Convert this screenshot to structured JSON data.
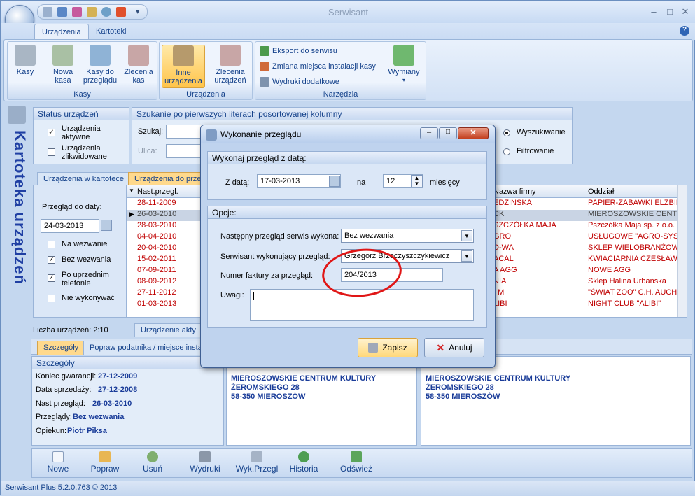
{
  "app": {
    "title": "Serwisant"
  },
  "ribbon": {
    "tabs": [
      "Urządzenia",
      "Kartoteki"
    ],
    "groups": {
      "kasy": {
        "title": "Kasy",
        "buttons": [
          "Kasy",
          "Nowa kasa",
          "Kasy do przeglądu",
          "Zlecenia kas"
        ]
      },
      "urzadzenia": {
        "title": "Urządzenia",
        "buttons": [
          "Inne urządzenia",
          "Zlecenia urządzeń"
        ]
      },
      "narzedzia": {
        "title": "Narzędzia",
        "small": [
          "Eksport do serwisu",
          "Zmiana miejsca instalacji kasy",
          "Wydruki dodatkowe"
        ],
        "big": "Wymiany"
      }
    }
  },
  "side_title": "Kartoteka urządzeń",
  "status_panel": {
    "title": "Status urządzeń",
    "opt1": "Urządzenia aktywne",
    "opt2": "Urządzenia zlikwidowane"
  },
  "search_panel": {
    "title": "Szukanie po pierwszych literach posortowanej kolumny",
    "szukaj": "Szukaj:",
    "ulica": "Ulica:",
    "mode1": "Wyszukiwanie",
    "mode2": "Filtrowanie"
  },
  "list_tabs": [
    "Urządzenia w kartotece",
    "Urządzenia do przeglądu"
  ],
  "filter": {
    "label": "Przegląd do daty:",
    "date": "24-03-2013",
    "opts": [
      "Na wezwanie",
      "Bez wezwania",
      "Po uprzednim telefonie",
      "Nie wykonywać"
    ]
  },
  "grid": {
    "col1": "Nast.przegl.",
    "col2": "Nazwa firmy",
    "col3": "Oddział",
    "rows": [
      {
        "d": "28-11-2009",
        "f": "EDZIŃSKA",
        "o": "PAPIER-ZABAWKI ELŻBIET"
      },
      {
        "d": "26-03-2010",
        "f": "CK",
        "o": "MIEROSZOWSKIE CENTRUM"
      },
      {
        "d": "28-03-2010",
        "f": "SZCZÓŁKA MAJA",
        "o": "Pszczółka Maja sp. z o.o."
      },
      {
        "d": "04-04-2010",
        "f": "GRO",
        "o": "USŁUGOWE \"AGRO-SYSTE"
      },
      {
        "d": "20-04-2010",
        "f": "D-WA",
        "o": "SKLEP WIELOBRANŻOWY"
      },
      {
        "d": "15-02-2011",
        "f": "ACAL",
        "o": "KWIACIARNIA CZESŁAWA"
      },
      {
        "d": "07-09-2011",
        "f": "A AGG",
        "o": "NOWE AGG"
      },
      {
        "d": "08-09-2012",
        "f": "NIA",
        "o": "Sklep  Halina Urbańska"
      },
      {
        "d": "27-11-2012",
        "f": "I M",
        "o": "\"ŚWIAT ZOO\" C.H. AUCHA"
      },
      {
        "d": "01-03-2013",
        "f": "LIBI",
        "o": "NIGHT CLUB \"ALIBI\""
      }
    ]
  },
  "count": "Liczba urządzeń:  2:10",
  "aktywne_tab": "Urządzenie akty",
  "detail_tabs": [
    "Szczegóły",
    "Popraw podatnika / miejsce instal"
  ],
  "details": {
    "title": "Szczegóły",
    "gwarancja_label": "Koniec gwarancji:",
    "gwarancja": "27-12-2009",
    "sprzedaz_label": "Data sprzedaży:",
    "sprzedaz": "27-12-2008",
    "przeglad_label": "Nast przegląd:",
    "przeglad": "26-03-2010",
    "przeglady_label": "Przeglądy:",
    "przeglady": "Bez wezwania",
    "opiekun_label": "Opiekun:",
    "opiekun": "Piotr Piksa"
  },
  "addr1": [
    "MIEROSZOWSKIE CENTRUM KULTURY",
    "ŻEROMSKIEGO 28",
    "58-350 MIEROSZÓW"
  ],
  "addr2": [
    "MIEROSZOWSKIE CENTRUM KULTURY",
    "ŻEROMSKIEGO 28",
    "58-350 MIEROSZÓW"
  ],
  "toolbar": [
    "Nowe",
    "Popraw",
    "Usuń",
    "Wydruki",
    "Wyk.Przegl",
    "Historia",
    "Odśwież"
  ],
  "statusbar": "Serwisant Plus 5.2.0.763 © 2013",
  "dialog": {
    "title": "Wykonanie przeglądu",
    "sec1": "Wykonaj przegląd z datą:",
    "zdata_label": "Z datą:",
    "zdata": "17-03-2013",
    "na": "na",
    "months": "12",
    "miesiecy": "miesięcy",
    "sec2": "Opcje:",
    "next_label": "Następny przegląd serwis wykona:",
    "next": "Bez wezwania",
    "tech_label": "Serwisant wykonujący przegląd:",
    "tech": "Grzegorz Brzeczyszczykiewicz",
    "invoice_label": "Numer faktury za przegląd:",
    "invoice": "204/2013",
    "notes_label": "Uwagi:",
    "save": "Zapisz",
    "cancel": "Anuluj"
  }
}
